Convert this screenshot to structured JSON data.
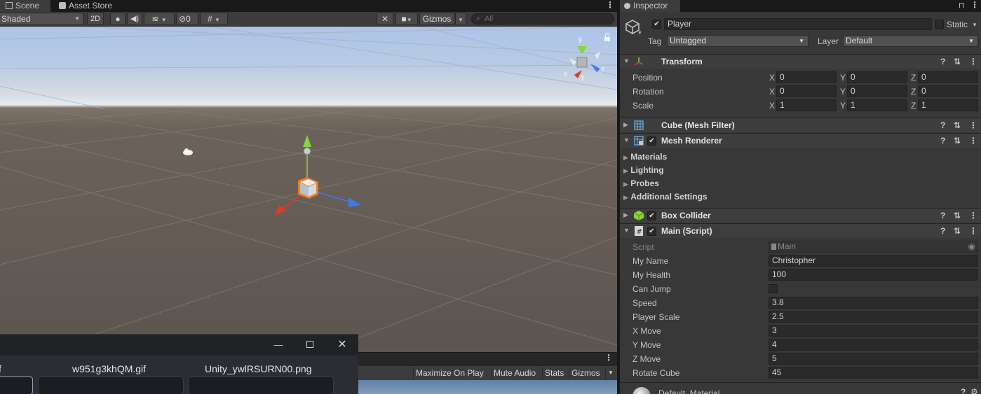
{
  "scene_tabs": {
    "scene": "Scene",
    "asset_store": "Asset Store"
  },
  "scene_toolbar": {
    "draw_mode": "Shaded",
    "mode_2d": "2D",
    "hidden_count": "0",
    "gizmos": "Gizmos",
    "search_placeholder": "All"
  },
  "orientation_gizmo": {
    "x": "x",
    "y": "y",
    "z": "z"
  },
  "game_toolbar": {
    "maximize_on_play": "Maximize On Play",
    "mute_audio": "Mute Audio",
    "stats": "Stats",
    "gizmos": "Gizmos"
  },
  "float_window": {
    "files": [
      "f",
      "w951g3khQM.gif",
      "Unity_ywlRSURN00.png"
    ]
  },
  "inspector": {
    "tab": "Inspector",
    "object_name": "Player",
    "static_label": "Static",
    "tag_label": "Tag",
    "tag_value": "Untagged",
    "layer_label": "Layer",
    "layer_value": "Default",
    "transform": {
      "title": "Transform",
      "position": {
        "label": "Position",
        "x": "0",
        "y": "0",
        "z": "0"
      },
      "rotation": {
        "label": "Rotation",
        "x": "0",
        "y": "0",
        "z": "0"
      },
      "scale": {
        "label": "Scale",
        "x": "1",
        "y": "1",
        "z": "1"
      },
      "axis_x": "X",
      "axis_y": "Y",
      "axis_z": "Z"
    },
    "mesh_filter": {
      "title": "Cube (Mesh Filter)"
    },
    "mesh_renderer": {
      "title": "Mesh Renderer",
      "sections": [
        "Materials",
        "Lighting",
        "Probes",
        "Additional Settings"
      ]
    },
    "box_collider": {
      "title": "Box Collider"
    },
    "main_script": {
      "title": "Main (Script)",
      "script_label": "Script",
      "script_value": "Main",
      "fields": [
        {
          "label": "My Name",
          "value": "Christopher"
        },
        {
          "label": "My Health",
          "value": "100"
        },
        {
          "label": "Can Jump",
          "value": ""
        },
        {
          "label": "Speed",
          "value": "3.8"
        },
        {
          "label": "Player Scale",
          "value": "2.5"
        },
        {
          "label": "X Move",
          "value": "3"
        },
        {
          "label": "Y Move",
          "value": "4"
        },
        {
          "label": "Z Move",
          "value": "5"
        },
        {
          "label": "Rotate Cube",
          "value": "45"
        }
      ]
    },
    "material": {
      "title": "Default_Material"
    }
  },
  "colors": {
    "panel": "#383838",
    "toolbar": "#3c3c3c",
    "field": "#2a2a2a",
    "selection_orange": "#f07d1e",
    "axis_x": "#e0392a",
    "axis_y": "#8ad33a",
    "axis_z": "#3f7be6"
  }
}
